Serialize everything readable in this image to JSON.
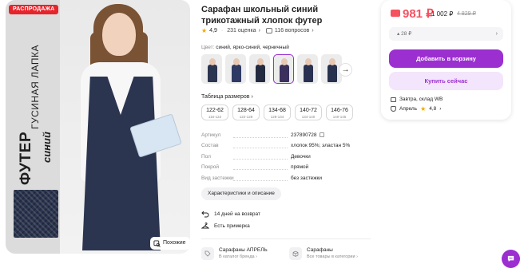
{
  "photo": {
    "badge": "РАСПРОДАЖА",
    "vertical_big": "ФУТЕР",
    "vertical_mid": "ГУСИНАЯ ЛАПКА",
    "vertical_small": "синий",
    "similar_label": "Похожие"
  },
  "product": {
    "title": "Сарафан школьный синий трикотажный хлопок футер",
    "rating": "4,9",
    "reviews": "231 оценка",
    "questions": "116 вопросов"
  },
  "color": {
    "label": "Цвет:",
    "value": "синий, ярко-синий, черничный",
    "thumb_colors": [
      "#2b3550",
      "#2e3a64",
      "#232a40",
      "#3b2f5e",
      "#2a3150",
      "#28324e"
    ],
    "active_index": 3
  },
  "sizes": {
    "title": "Таблица размеров",
    "items": [
      {
        "main": "122-62",
        "sub": "116-122"
      },
      {
        "main": "128-64",
        "sub": "122-128"
      },
      {
        "main": "134-68",
        "sub": "128-134"
      },
      {
        "main": "140-72",
        "sub": "134-140"
      },
      {
        "main": "146-76",
        "sub": "140-146"
      }
    ]
  },
  "specs": [
    {
      "key": "Артикул",
      "value": "237890728"
    },
    {
      "key": "Состав",
      "value": "хлопок 95%; эластан 5%"
    },
    {
      "key": "Пол",
      "value": "Девочки"
    },
    {
      "key": "Покрой",
      "value": "прямой"
    },
    {
      "key": "Вид застежки",
      "value": "без застежки"
    }
  ],
  "characteristics_button": "Характеристики и описание",
  "info": {
    "return_text": "14 дней на возврат",
    "fitting_text": "Есть примерка"
  },
  "brand_cards": [
    {
      "title": "Сарафаны АПРЕЛЬ",
      "subtitle": "В каталог бренда"
    },
    {
      "title": "Сарафаны",
      "subtitle": "Все товары в категории"
    }
  ],
  "price": {
    "main": "981 ₽",
    "secondary": "1 002 ₽",
    "old": "4 829 ₽",
    "installment": "28 ₽",
    "cart_button": "Добавить в корзину",
    "buy_button": "Купить сейчас",
    "delivery": "Завтра, склад WB",
    "seller_name": "Апрель",
    "seller_rating": "4,8",
    "accent": "#9b2fd0",
    "price_color": "#f5515f"
  }
}
